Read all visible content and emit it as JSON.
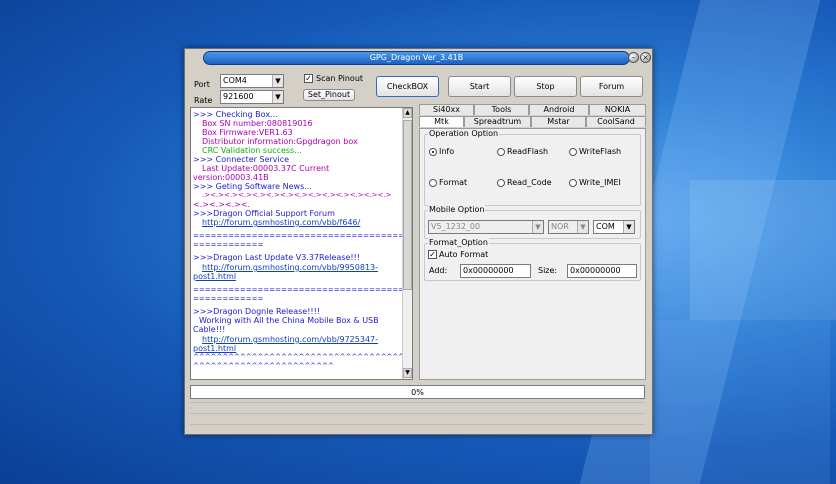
{
  "window": {
    "title": "GPG_Dragon  Ver_3.41B",
    "minimize_icon": "minimize-icon",
    "close_icon": "close-icon"
  },
  "port": {
    "label": "Port",
    "value": "COM4"
  },
  "rate": {
    "label": "Rate",
    "value": "921600"
  },
  "scan_pinout": {
    "label": "Scan Pinout",
    "checked": true
  },
  "set_pinout_label": "Set_Pinout",
  "buttons": {
    "checkbox": "CheckBOX",
    "start": "Start",
    "stop": "Stop",
    "forum": "Forum"
  },
  "log": {
    "lines": [
      ">>> Checking Box...",
      "Box SN number:080819016",
      "Box Firmware:VER1.63",
      "Distributor information:Gpgdragon box",
      "CRC Validation success...",
      ">>> Connecter Service",
      "Last Update:00003.37C Current",
      "version:00003.41B",
      ">>> Geting Software News...",
      ".><.><.><.><.><.><.><.><.><.><.><.><.><.>",
      "<.><.><.><.",
      ">>>Dragon Official Support Forum",
      "http://forum.gsmhosting.com/vbb/f646/",
      "=======================================",
      "============",
      ">>>Dragon Last Update V3.37Release!!!",
      "http://forum.gsmhosting.com/vbb/9950813-",
      "post1.html",
      "=======================================",
      "============",
      ">>>Dragon Dognle Release!!!!",
      "Working with All the China Mobile Box & USB",
      "Cable!!!",
      "http://forum.gsmhosting.com/vbb/9725347-",
      "post1.html",
      "^^^^^^^^^^^^^^^^^^^^^^^^^^^^^^^^^^^^^^^^",
      "^^^^^^^^^^^^^^^^^^^^^^^^"
    ]
  },
  "tabs_row1": [
    "Si40xx",
    "Tools",
    "Android",
    "NOKIA"
  ],
  "tabs_row2": [
    "Mtk",
    "Spreadtrum",
    "Mstar",
    "CoolSand"
  ],
  "operation_option": {
    "title": "Operation Option",
    "radios": [
      "Info",
      "ReadFlash",
      "WriteFlash",
      "Format",
      "Read_Code",
      "Write_IMEI"
    ],
    "selected": "Info"
  },
  "mobile_option": {
    "title": "Mobile Option",
    "model": "V5_1232_00",
    "memory": "NOR",
    "port": "COM"
  },
  "format_option": {
    "title": "Format_Option",
    "auto_format_label": "Auto Format",
    "auto_format_checked": true,
    "add_label": "Add:",
    "add_value": "0x00000000",
    "size_label": "Size:",
    "size_value": "0x00000000"
  },
  "progress": {
    "text": "0%",
    "percent": 0
  }
}
